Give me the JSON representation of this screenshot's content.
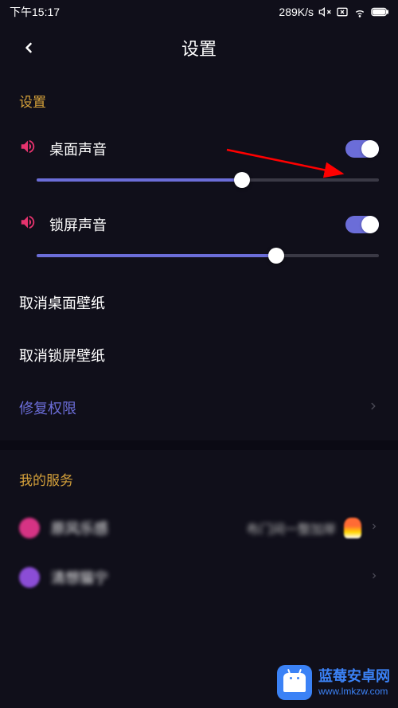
{
  "statusBar": {
    "time": "下午15:17",
    "speed": "289K/s"
  },
  "header": {
    "title": "设置"
  },
  "settings": {
    "sectionTitle": "设置",
    "desktopSound": {
      "label": "桌面声音",
      "enabled": true,
      "volume": 60
    },
    "lockscreenSound": {
      "label": "锁屏声音",
      "enabled": true,
      "volume": 70
    },
    "cancelDesktopWallpaper": "取消桌面壁纸",
    "cancelLockscreenWallpaper": "取消锁屏壁纸",
    "fixPermissions": "修复权限"
  },
  "services": {
    "sectionTitle": "我的服务",
    "items": [
      {
        "label": "原风乐感",
        "sublabel": "布门间一整加岸",
        "iconColor": "pink",
        "hasFlame": true
      },
      {
        "label": "清想猫宁",
        "iconColor": "purple"
      }
    ]
  },
  "watermark": {
    "title": "蓝莓安卓网",
    "url": "www.lmkzw.com"
  },
  "colors": {
    "accent": "#6b6dd8",
    "sectionTitle": "#d4a03a",
    "soundIcon": "#e6336e",
    "background": "#100f1a"
  }
}
